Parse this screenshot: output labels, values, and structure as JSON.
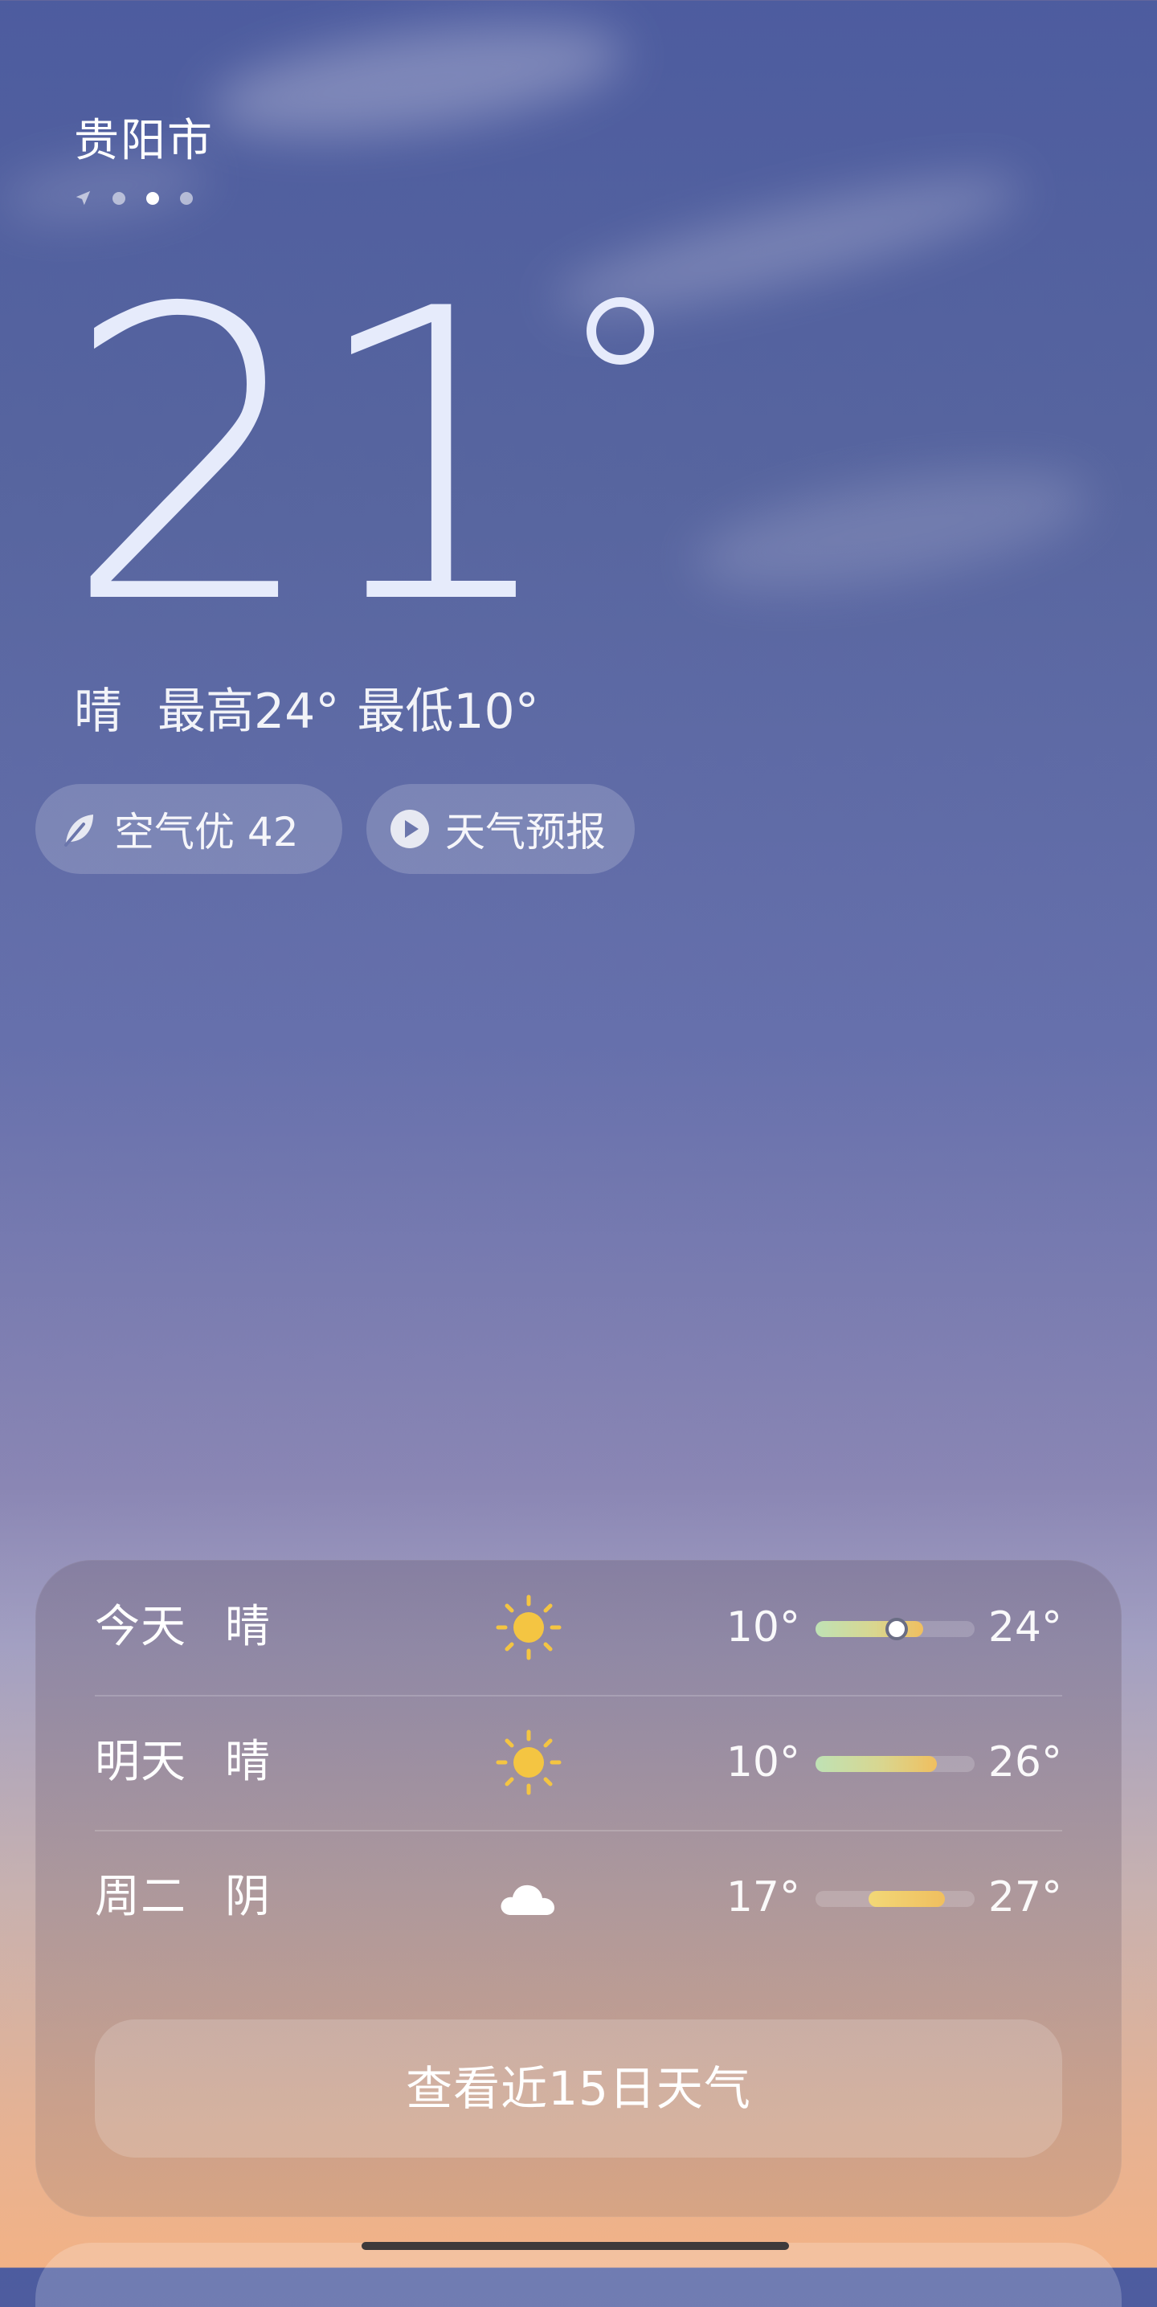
{
  "header": {
    "city": "贵阳市",
    "pages": {
      "location_icon": "navigation-arrow-icon",
      "count": 3,
      "active_index": 1
    }
  },
  "current": {
    "temperature": "21",
    "condition": "晴",
    "high": "最高24°",
    "low": "最低10°"
  },
  "chips": {
    "air": {
      "icon": "leaf-icon",
      "label": "空气优 42"
    },
    "forecast": {
      "icon": "play-icon",
      "label": "天气预报"
    }
  },
  "forecast": {
    "rows": [
      {
        "day": "今天",
        "condition": "晴",
        "icon": "sun-icon",
        "low": "10°",
        "high": "24°",
        "range": {
          "low": 10,
          "high": 24,
          "current": 21
        }
      },
      {
        "day": "明天",
        "condition": "晴",
        "icon": "sun-icon",
        "low": "10°",
        "high": "26°",
        "range": {
          "low": 10,
          "high": 26
        }
      },
      {
        "day": "周二",
        "condition": "阴",
        "icon": "cloud-icon",
        "low": "17°",
        "high": "27°",
        "range": {
          "low": 17,
          "high": 27
        }
      }
    ],
    "button_label": "查看近15日天气"
  },
  "colors": {
    "sky_top": "#4d5c9f",
    "sky_bottom": "#f2b286",
    "sun": "#f4c542",
    "range_cool": "#bfe2b5",
    "range_warm": "#f0bf5f"
  }
}
